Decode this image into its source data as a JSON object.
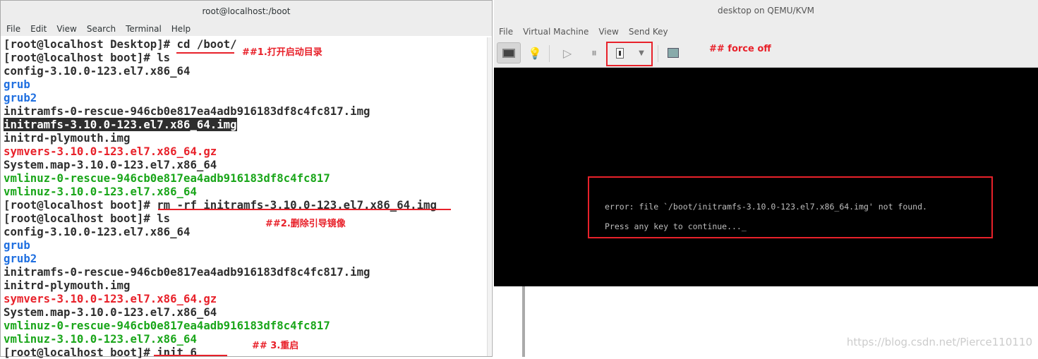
{
  "terminal": {
    "title": "root@localhost:/boot",
    "menu": [
      "File",
      "Edit",
      "View",
      "Search",
      "Terminal",
      "Help"
    ],
    "lines": [
      {
        "text": "[root@localhost Desktop]# cd /boot/",
        "color": "default"
      },
      {
        "text": "[root@localhost boot]# ls",
        "color": "default"
      },
      {
        "text": "config-3.10.0-123.el7.x86_64",
        "color": "default"
      },
      {
        "text": "grub",
        "color": "blue"
      },
      {
        "text": "grub2",
        "color": "blue"
      },
      {
        "text": "initramfs-0-rescue-946cb0e817ea4adb916183df8c4fc817.img",
        "color": "default"
      },
      {
        "text": "initramfs-3.10.0-123.el7.x86_64.img",
        "color": "highlight"
      },
      {
        "text": "initrd-plymouth.img",
        "color": "default"
      },
      {
        "text": "symvers-3.10.0-123.el7.x86_64.gz",
        "color": "red"
      },
      {
        "text": "System.map-3.10.0-123.el7.x86_64",
        "color": "default"
      },
      {
        "text": "vmlinuz-0-rescue-946cb0e817ea4adb916183df8c4fc817",
        "color": "green"
      },
      {
        "text": "vmlinuz-3.10.0-123.el7.x86_64",
        "color": "green"
      },
      {
        "text": "[root@localhost boot]# rm -rf initramfs-3.10.0-123.el7.x86_64.img",
        "color": "default"
      },
      {
        "text": "[root@localhost boot]# ls",
        "color": "default"
      },
      {
        "text": "config-3.10.0-123.el7.x86_64",
        "color": "default"
      },
      {
        "text": "grub",
        "color": "blue"
      },
      {
        "text": "grub2",
        "color": "blue"
      },
      {
        "text": "initramfs-0-rescue-946cb0e817ea4adb916183df8c4fc817.img",
        "color": "default"
      },
      {
        "text": "initrd-plymouth.img",
        "color": "default"
      },
      {
        "text": "symvers-3.10.0-123.el7.x86_64.gz",
        "color": "red"
      },
      {
        "text": "System.map-3.10.0-123.el7.x86_64",
        "color": "default"
      },
      {
        "text": "vmlinuz-0-rescue-946cb0e817ea4adb916183df8c4fc817",
        "color": "green"
      },
      {
        "text": "vmlinuz-3.10.0-123.el7.x86_64",
        "color": "green"
      },
      {
        "text": "[root@localhost boot]# init 6",
        "color": "default"
      }
    ]
  },
  "annotations": {
    "step1": "##1.打开启动目录",
    "step2": "##2.删除引导镜像",
    "step3": "## 3.重启",
    "force_off": "## force off"
  },
  "vm": {
    "title": "desktop on QEMU/KVM",
    "menu": [
      "File",
      "Virtual Machine",
      "View",
      "Send Key"
    ],
    "toolbar": [
      "monitor-icon",
      "lightbulb-icon",
      "play-icon",
      "pause-icon",
      "power-switch-icon",
      "dropdown-arrow-icon",
      "screenshot-icon"
    ],
    "console": {
      "error": "error: file `/boot/initramfs-3.10.0-123.el7.x86_64.img' not found.",
      "prompt": "Press any key to continue..._"
    }
  },
  "watermark": "https://blog.csdn.net/Pierce110110",
  "colors": {
    "annotation": "#e8212a",
    "blue": "#1f6fe0",
    "green": "#1aa61a",
    "red": "#e8212a"
  }
}
